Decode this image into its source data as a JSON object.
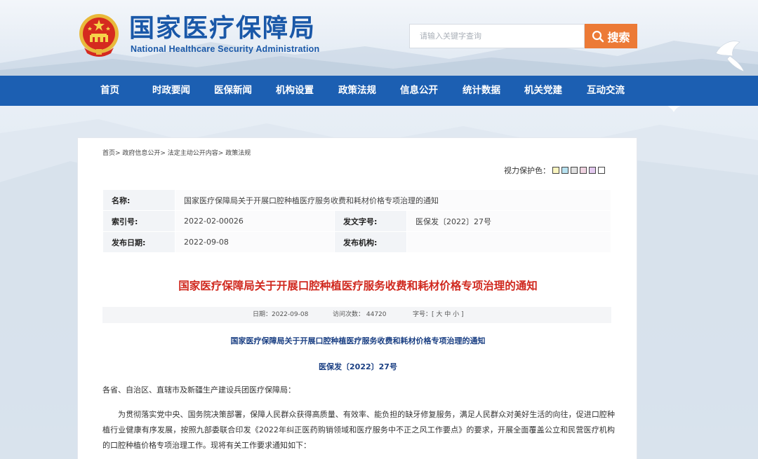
{
  "header": {
    "logo_cn": "国家医疗保障局",
    "logo_en": "National Healthcare Security Administration",
    "search_placeholder": "请输入关键字查询",
    "search_label": "搜索"
  },
  "nav": [
    "首页",
    "时政要闻",
    "医保新闻",
    "机构设置",
    "政策法规",
    "信息公开",
    "统计数据",
    "机关党建",
    "互动交流"
  ],
  "breadcrumb": "首页> 政府信息公开> 法定主动公开内容> 政策法规",
  "eye_protect": {
    "label": "视力保护色：",
    "colors": [
      "#faf5c0",
      "#b8e2f0",
      "#e0e0e0",
      "#efd3e0",
      "#e3c9ef",
      "#ffffff"
    ]
  },
  "info": {
    "name_label": "名称:",
    "name_value": "国家医疗保障局关于开展口腔种植医疗服务收费和耗材价格专项治理的通知",
    "index_label": "索引号:",
    "index_value": "2022-02-00026",
    "docno_label": "发文字号:",
    "docno_value": "医保发〔2022〕27号",
    "date_label": "发布日期:",
    "date_value": "2022-09-08",
    "org_label": "发布机构:",
    "org_value": ""
  },
  "doc": {
    "title": "国家医疗保障局关于开展口腔种植医疗服务收费和耗材价格专项治理的通知",
    "meta_date": "日期：2022-09-08",
    "meta_visits": "访问次数：  44720",
    "meta_font": "字号：[ 大 中 小 ]",
    "sub_title": "国家医疗保障局关于开展口腔种植医疗服务收费和耗材价格专项治理的通知",
    "doc_no": "医保发〔2022〕27号",
    "salutation": "各省、自治区、直辖市及新疆生产建设兵团医疗保障局：",
    "body": "为贯彻落实党中央、国务院决策部署，保障人民群众获得高质量、有效率、能负担的缺牙修复服务，满足人民群众对美好生活的向往，促进口腔种植行业健康有序发展，按照九部委联合印发《2022年纠正医药购销领域和医疗服务中不正之风工作要点》的要求，开展全面覆盖公立和民营医疗机构的口腔种植价格专项治理工作。现将有关工作要求通知如下："
  }
}
